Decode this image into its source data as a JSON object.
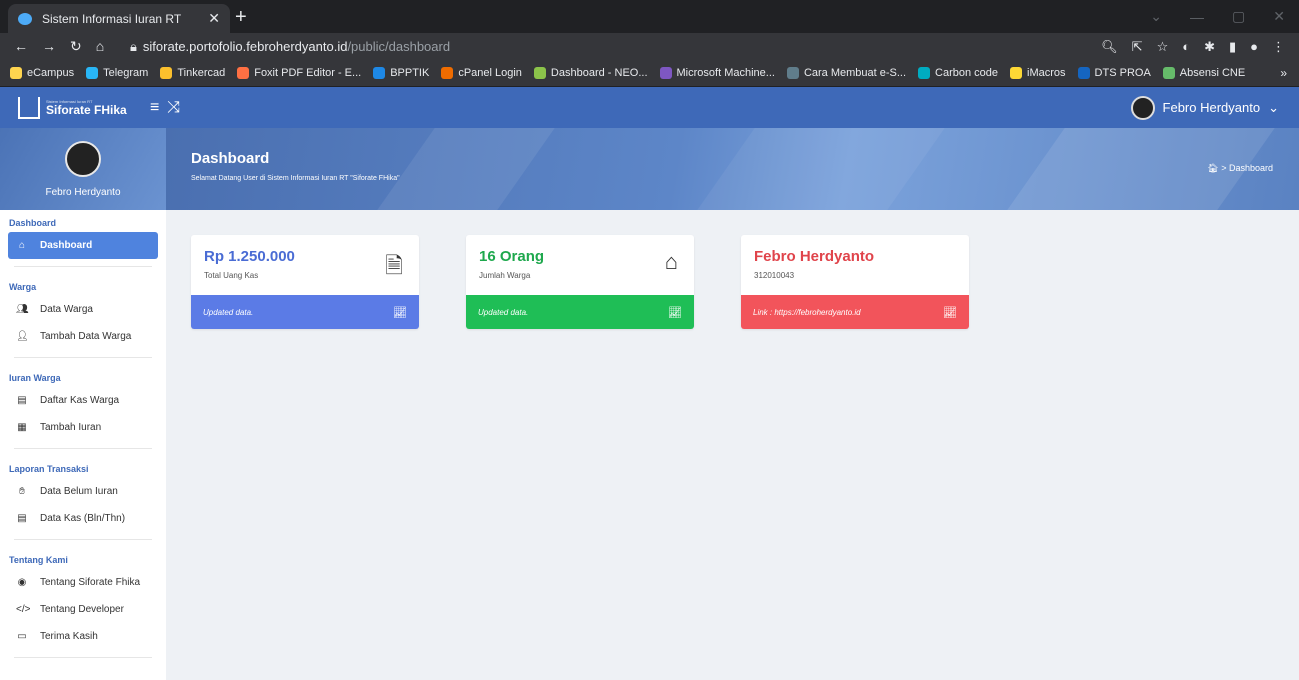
{
  "browser": {
    "tab_title": "Sistem Informasi Iuran RT",
    "url_host": "siforate.portofolio.febroherdyanto.id",
    "url_path": "/public/dashboard",
    "bookmarks": [
      "eCampus",
      "Telegram",
      "Tinkercad",
      "Foxit PDF Editor - E...",
      "BPPTIK",
      "cPanel Login",
      "Dashboard - NEO...",
      "Microsoft Machine...",
      "Cara Membuat e-S...",
      "Carbon code",
      "iMacros",
      "DTS PROA",
      "Absensi CNE"
    ],
    "bookmark_colors": [
      "#ffd54f",
      "#29b6f6",
      "#fbc02d",
      "#ff7043",
      "#1e88e5",
      "#ef6c00",
      "#8bc34a",
      "#7e57c2",
      "#607d8b",
      "#00acc1",
      "#fdd835",
      "#1565c0",
      "#66bb6a"
    ]
  },
  "header": {
    "app_subtitle": "Sistem Informasi Iuran RT",
    "app_name": "Siforate FHika",
    "user_name": "Febro Herdyanto"
  },
  "sidebar": {
    "profile_name": "Febro Herdyanto",
    "sections": [
      {
        "title": "Dashboard",
        "items": [
          {
            "label": "Dashboard",
            "icon": "home-icon",
            "active": true
          }
        ]
      },
      {
        "title": "Warga",
        "items": [
          {
            "label": "Data Warga",
            "icon": "users-icon"
          },
          {
            "label": "Tambah Data Warga",
            "icon": "user-plus-icon"
          }
        ]
      },
      {
        "title": "Iuran Warga",
        "items": [
          {
            "label": "Daftar Kas Warga",
            "icon": "file-invoice-icon"
          },
          {
            "label": "Tambah Iuran",
            "icon": "cash-register-icon"
          }
        ]
      },
      {
        "title": "Laporan Transaksi",
        "items": [
          {
            "label": "Data Belum Iuran",
            "icon": "hand-holding-icon"
          },
          {
            "label": "Data Kas (Bln/Thn)",
            "icon": "file-invoice-icon"
          }
        ]
      },
      {
        "title": "Tentang Kami",
        "items": [
          {
            "label": "Tentang Siforate Fhika",
            "icon": "compass-icon"
          },
          {
            "label": "Tentang Developer",
            "icon": "code-icon"
          },
          {
            "label": "Terima Kasih",
            "icon": "thanks-icon"
          }
        ]
      }
    ]
  },
  "banner": {
    "title": "Dashboard",
    "subtitle": "Selamat Datang User di Sistem Informasi Iuran RT \"Siforate FHika\"",
    "breadcrumb": "> Dashboard"
  },
  "cards": [
    {
      "value": "Rp 1.250.000",
      "label": "Total Uang Kas",
      "footer": "Updated data.",
      "icon": "money-file-icon",
      "color": "#5b7be6",
      "value_color": "#4a6cd4"
    },
    {
      "value": "16 Orang",
      "label": "Jumlah Warga",
      "footer": "Updated data.",
      "icon": "house-people-icon",
      "color": "#1fbe56",
      "value_color": "#1ea84d"
    },
    {
      "value": "Febro Herdyanto",
      "label": "312010043",
      "footer": "Link : https://febroherdyanto.id",
      "icon": "none",
      "color": "#f2545b",
      "value_color": "#e0444b"
    }
  ]
}
